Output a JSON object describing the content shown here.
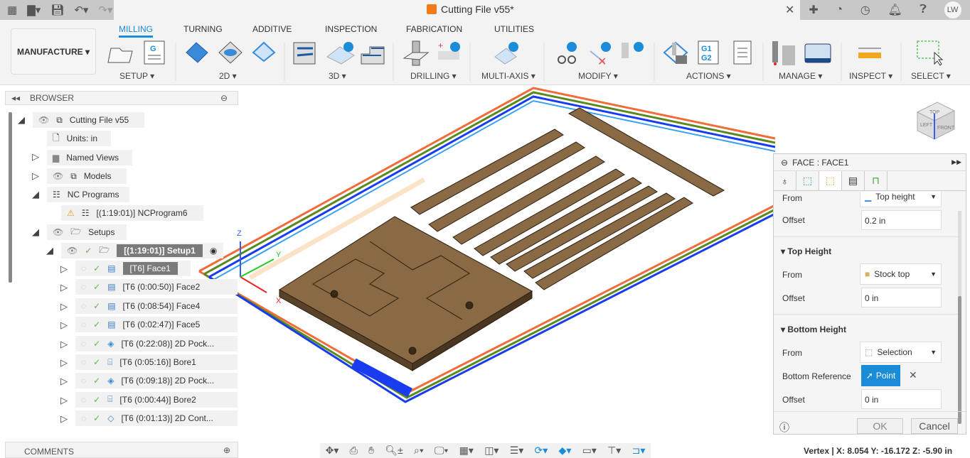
{
  "app": {
    "title": "Cutting File v55*",
    "user_initials": "LW"
  },
  "toolbar": {
    "workspace": "MANUFACTURE ▾",
    "tabs": [
      "MILLING",
      "TURNING",
      "ADDITIVE",
      "INSPECTION",
      "FABRICATION",
      "UTILITIES"
    ],
    "active_tab": "MILLING",
    "groups": [
      "SETUP ▾",
      "2D ▾",
      "3D ▾",
      "DRILLING ▾",
      "MULTI-AXIS ▾",
      "MODIFY ▾",
      "ACTIONS ▾",
      "MANAGE ▾",
      "INSPECT ▾",
      "SELECT ▾"
    ]
  },
  "browser": {
    "title": "BROWSER",
    "root": "Cutting File v55",
    "units": "Units: in",
    "named_views": "Named Views",
    "models": "Models",
    "nc_programs": "NC Programs",
    "nc_program": "[(1:19:01)] NCProgram6",
    "setups": "Setups",
    "setup": "[(1:19:01)] Setup1",
    "operations": [
      {
        "label": "[T6] Face1",
        "icon": "face-icon"
      },
      {
        "label": "[T6 (0:00:50)] Face2",
        "icon": "face-icon"
      },
      {
        "label": "[T6 (0:08:54)] Face4",
        "icon": "face-icon"
      },
      {
        "label": "[T6 (0:02:47)] Face5",
        "icon": "face-icon"
      },
      {
        "label": "[T6 (0:22:08)] 2D Pock...",
        "icon": "pocket-icon"
      },
      {
        "label": "[T6 (0:05:16)] Bore1",
        "icon": "bore-icon"
      },
      {
        "label": "[T6 (0:09:18)] 2D Pock...",
        "icon": "pocket-icon"
      },
      {
        "label": "[T6 (0:00:44)] Bore2",
        "icon": "bore-icon"
      },
      {
        "label": "[T6 (0:01:13)] 2D Cont...",
        "icon": "contour-icon"
      }
    ]
  },
  "comments": {
    "title": "COMMENTS"
  },
  "viewport": {
    "axis_x": "X",
    "axis_y": "Y",
    "axis_z": "Z",
    "viewcube": {
      "top": "TOP",
      "front": "FRONT",
      "left": "LEFT"
    }
  },
  "panel": {
    "title": "FACE : FACE1",
    "partial_from": {
      "label": "From",
      "value": "Top height"
    },
    "partial_offset": {
      "label": "Offset",
      "value": "0.2 in"
    },
    "top_height": {
      "title": "Top Height",
      "from_label": "From",
      "from_value": "Stock top",
      "offset_label": "Offset",
      "offset_value": "0 in"
    },
    "bottom_height": {
      "title": "Bottom Height",
      "from_label": "From",
      "from_value": "Selection",
      "ref_label": "Bottom Reference",
      "ref_value": "Point",
      "offset_label": "Offset",
      "offset_value": "0 in"
    },
    "ok": "OK",
    "cancel": "Cancel"
  },
  "status": {
    "text": "Vertex | X: 8.054 Y: -16.172 Z: -5.90 in"
  },
  "colors": {
    "accent": "#1a8cd8",
    "wood": "#7a6040",
    "boundary_orange": "#f26b3a",
    "boundary_green": "#5a8a1e",
    "boundary_blue": "#1a3cf0"
  }
}
